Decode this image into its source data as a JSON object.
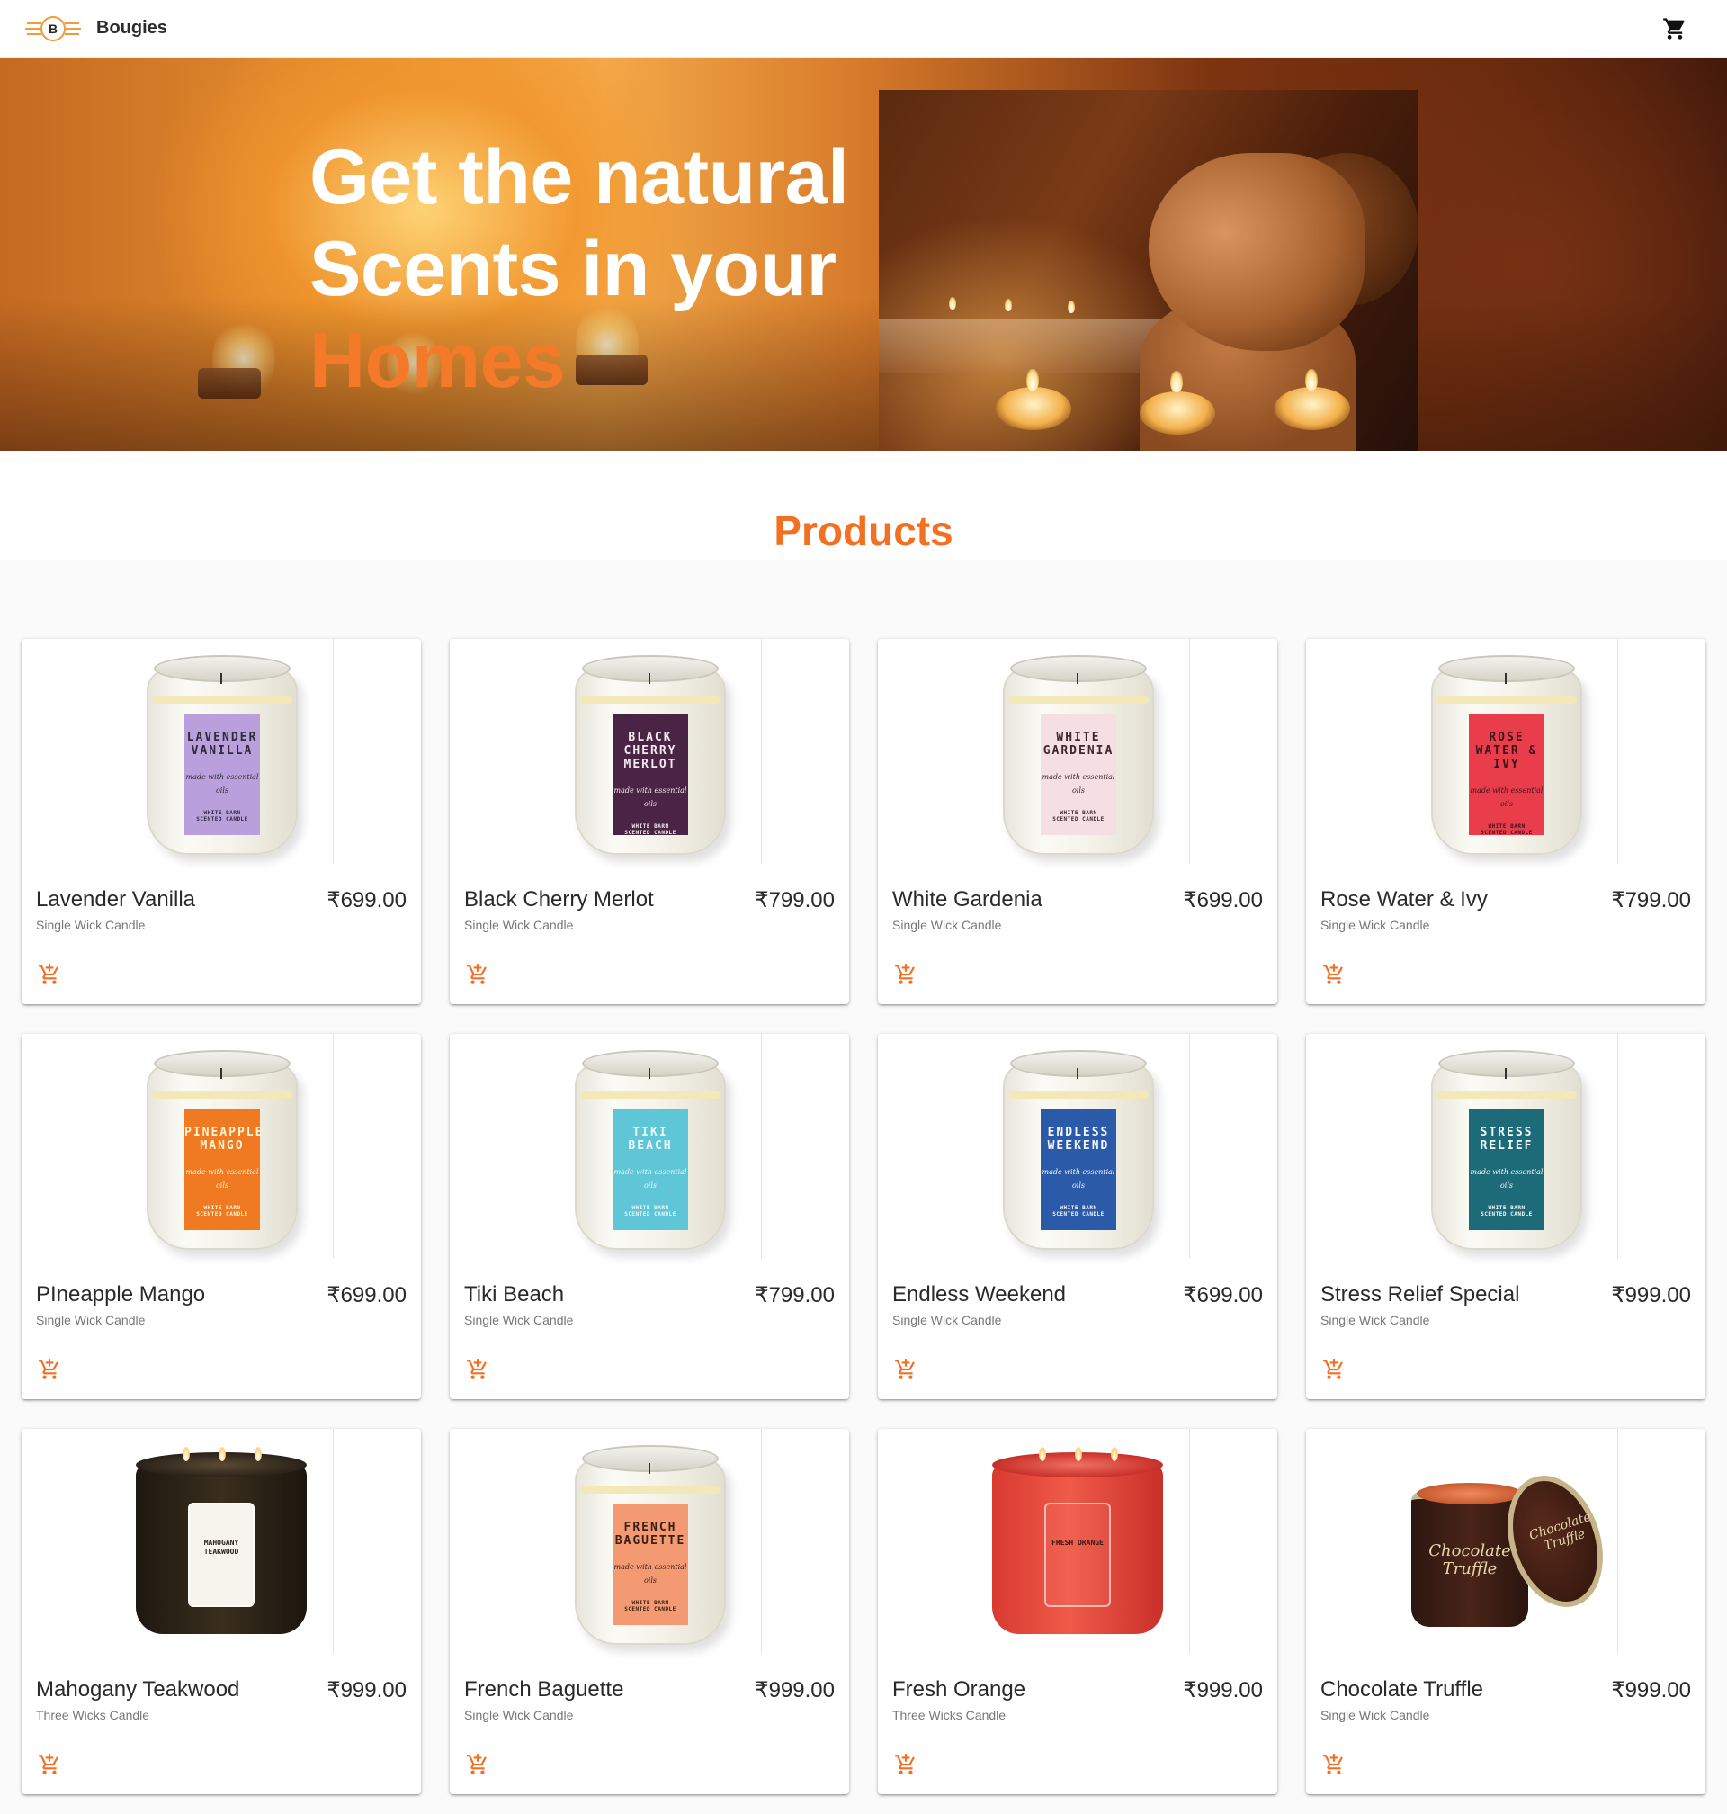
{
  "header": {
    "logo_letter": "B",
    "brand": "Bougies",
    "cart_icon": "shopping-cart-icon"
  },
  "hero": {
    "line1": "Get the natural",
    "line2": "Scents in your",
    "line3": "Homes"
  },
  "products_title": "Products",
  "colors": {
    "accent": "#f36f22",
    "text": "#2a2a2a",
    "subtext": "#777777",
    "grid_bg": "#fafafa"
  },
  "products": [
    {
      "name": "Lavender Vanilla",
      "price": "₹699.00",
      "type": "Single Wick Candle",
      "label_text": "LAVENDER VANILLA",
      "label_color": "#b9a0dc",
      "label_ink": "#2e2a3a",
      "style": "jar"
    },
    {
      "name": "Black Cherry Merlot",
      "price": "₹799.00",
      "type": "Single Wick Candle",
      "label_text": "BLACK CHERRY MERLOT",
      "label_color": "#4a2445",
      "label_ink": "#f4e9ef",
      "style": "jar"
    },
    {
      "name": "White Gardenia",
      "price": "₹699.00",
      "type": "Single Wick Candle",
      "label_text": "WHITE GARDENIA",
      "label_color": "#f6dfe2",
      "label_ink": "#3a2a2e",
      "style": "jar"
    },
    {
      "name": "Rose Water & Ivy",
      "price": "₹799.00",
      "type": "Single Wick Candle",
      "label_text": "ROSE WATER & IVY",
      "label_color": "#ea3d4c",
      "label_ink": "#3a1418",
      "style": "jar"
    },
    {
      "name": "PIneapple Mango",
      "price": "₹699.00",
      "type": "Single Wick Candle",
      "label_text": "PINEAPPLE MANGO",
      "label_color": "#f07a22",
      "label_ink": "#fff4d6",
      "style": "jar"
    },
    {
      "name": "Tiki Beach",
      "price": "₹799.00",
      "type": "Single Wick Candle",
      "label_text": "TIKI BEACH",
      "label_color": "#5fc6d8",
      "label_ink": "#e9f9fc",
      "style": "jar"
    },
    {
      "name": "Endless Weekend",
      "price": "₹699.00",
      "type": "Single Wick Candle",
      "label_text": "ENDLESS WEEKEND",
      "label_color": "#2b5aa8",
      "label_ink": "#f2f6ff",
      "style": "jar"
    },
    {
      "name": "Stress Relief Special",
      "price": "₹999.00",
      "type": "Single Wick Candle",
      "label_text": "STRESS RELIEF",
      "label_color": "#1d6b78",
      "label_ink": "#f2fbff",
      "style": "jar"
    },
    {
      "name": "Mahogany Teakwood",
      "price": "₹999.00",
      "type": "Three Wicks Candle",
      "label_text": "MAHOGANY TEAKWOOD",
      "label_color": "#2a2218",
      "label_ink": "#2a2218",
      "style": "threewick-dark"
    },
    {
      "name": "French Baguette",
      "price": "₹999.00",
      "type": "Single Wick Candle",
      "label_text": "FRENCH BAGUETTE",
      "label_color": "#f49a72",
      "label_ink": "#3a2014",
      "style": "jar"
    },
    {
      "name": "Fresh Orange",
      "price": "₹999.00",
      "type": "Three Wicks Candle",
      "label_text": "FRESH ORANGE",
      "label_color": "#e8453a",
      "label_ink": "#3a1410",
      "style": "threewick-red"
    },
    {
      "name": "Chocolate Truffle",
      "price": "₹999.00",
      "type": "Single Wick Candle",
      "label_text": "Chocolate Truffle",
      "label_color": "#3a1a10",
      "label_ink": "#e8d6b0",
      "style": "tin"
    }
  ]
}
